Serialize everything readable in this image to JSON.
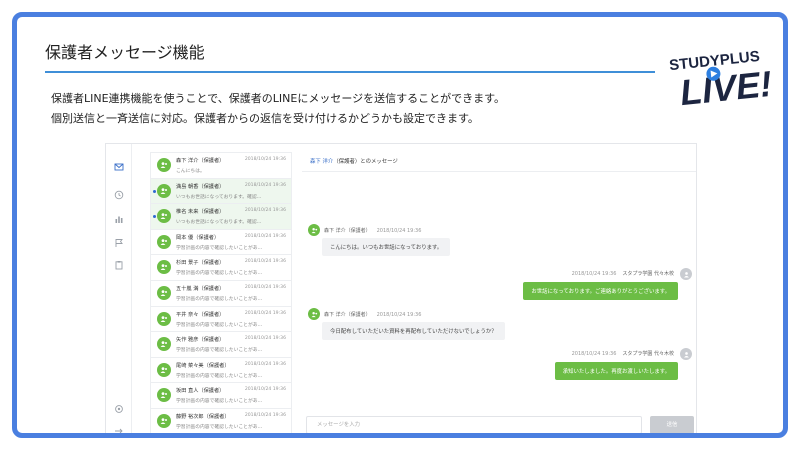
{
  "slide": {
    "title": "保護者メッセージ機能",
    "description": [
      "保護者LINE連携機能を使うことで、保護者のLINEにメッセージを送信することができます。",
      "個別送信と一斉送信に対応。保護者からの返信を受け付けるかどうかも設定できます。"
    ]
  },
  "logo": {
    "line1": "STUDYPLUS",
    "line2": "LIVE!"
  },
  "rail": [
    "mail-icon",
    "clock-icon",
    "chart-icon",
    "flag-icon",
    "clipboard-icon",
    "settings-icon",
    "logout-icon"
  ],
  "list": [
    {
      "name": "森下 洋介（保護者）",
      "date": "2018/10/24 19:36",
      "preview": "こんにちは。",
      "active": false,
      "unread": false
    },
    {
      "name": "満島 朝香（保護者）",
      "date": "2018/10/24 19:36",
      "preview": "いつもお世話になっております。確認…",
      "active": true,
      "unread": true
    },
    {
      "name": "椎名 未来（保護者）",
      "date": "2018/10/24 19:36",
      "preview": "いつもお世話になっております。確認…",
      "active": true,
      "unread": true
    },
    {
      "name": "岡本 優（保護者）",
      "date": "2018/10/24 19:36",
      "preview": "学習計画の内容で確認したいことがあ…",
      "active": false,
      "unread": false
    },
    {
      "name": "杉田 景子（保護者）",
      "date": "2018/10/24 19:36",
      "preview": "学習計画の内容で確認したいことがあ…",
      "active": false,
      "unread": false
    },
    {
      "name": "五十嵐 満（保護者）",
      "date": "2018/10/24 19:36",
      "preview": "学習計画の内容で確認したいことがあ…",
      "active": false,
      "unread": false
    },
    {
      "name": "平井 奈々（保護者）",
      "date": "2018/10/24 19:36",
      "preview": "学習計画の内容で確認したいことがあ…",
      "active": false,
      "unread": false
    },
    {
      "name": "矢作 雅彦（保護者）",
      "date": "2018/10/24 19:36",
      "preview": "学習計画の内容で確認したいことがあ…",
      "active": false,
      "unread": false
    },
    {
      "name": "尾崎 菜々美（保護者）",
      "date": "2018/10/24 19:36",
      "preview": "学習計画の内容で確認したいことがあ…",
      "active": false,
      "unread": false
    },
    {
      "name": "坂田 直人（保護者）",
      "date": "2018/10/24 19:36",
      "preview": "学習計画の内容で確認したいことがあ…",
      "active": false,
      "unread": false
    },
    {
      "name": "藤野 裕次郎（保護者）",
      "date": "2018/10/24 19:36",
      "preview": "学習計画の内容で確認したいことがあ…",
      "active": false,
      "unread": false
    }
  ],
  "chat": {
    "header_name": "森下 洋介",
    "header_suffix": "（保護者）とのメッセージ",
    "messages": [
      {
        "dir": "in",
        "sender": "森下 洋介（保護者）",
        "date": "2018/10/24 19:36",
        "text": "こんにちは。いつもお世話になっております。"
      },
      {
        "dir": "out",
        "sender": "スタプラ学園 代々木校",
        "date": "2018/10/24 19:36",
        "text": "お世話になっております。ご連絡ありがとうございます。"
      },
      {
        "dir": "in",
        "sender": "森下 洋介（保護者）",
        "date": "2018/10/24 19:36",
        "text": "今日配布していただいた資料を再配布していただけないでしょうか？"
      },
      {
        "dir": "out",
        "sender": "スタプラ学園 代々木校",
        "date": "2018/10/24 19:36",
        "text": "承知いたしました。再度お渡しいたします。"
      }
    ],
    "composer_placeholder": "メッセージを入力",
    "send_label": "送信"
  },
  "colors": {
    "frame": "#4a7fe0",
    "accent_green": "#6cbd45",
    "rule": "#3f8fd8"
  }
}
